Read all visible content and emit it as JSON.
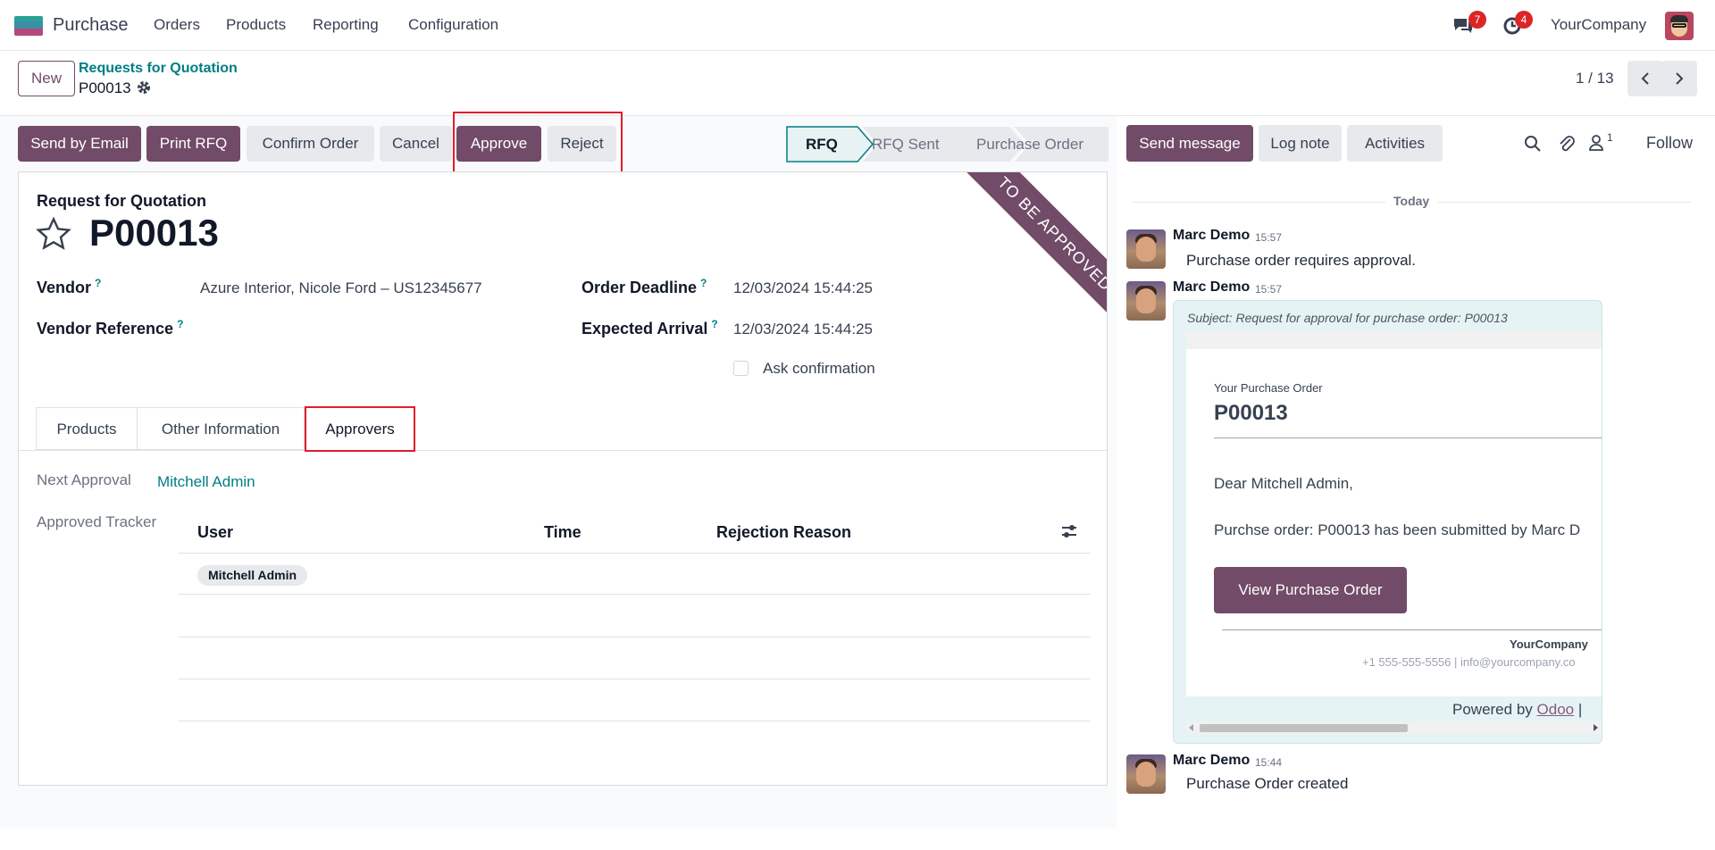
{
  "navbar": {
    "app_name": "Purchase",
    "menu": [
      "Orders",
      "Products",
      "Reporting",
      "Configuration"
    ],
    "messages_count": "7",
    "activities_count": "4",
    "company": "YourCompany"
  },
  "control_panel": {
    "new_label": "New",
    "breadcrumb_parent": "Requests for Quotation",
    "record_name": "P00013",
    "pager": "1 / 13"
  },
  "actions": {
    "send_by_email": "Send by Email",
    "print_rfq": "Print RFQ",
    "confirm_order": "Confirm Order",
    "cancel": "Cancel",
    "approve": "Approve",
    "reject": "Reject"
  },
  "statusbar": {
    "stages": [
      "RFQ",
      "RFQ Sent",
      "Purchase Order"
    ],
    "active": "RFQ"
  },
  "form": {
    "doc_type": "Request for Quotation",
    "name": "P00013",
    "ribbon": "TO BE APPROVED",
    "vendor_label": "Vendor",
    "vendor_value": "Azure Interior, Nicole Ford – US12345677",
    "vendor_ref_label": "Vendor Reference",
    "order_deadline_label": "Order Deadline",
    "order_deadline_value": "12/03/2024 15:44:25",
    "expected_arrival_label": "Expected Arrival",
    "expected_arrival_value": "12/03/2024 15:44:25",
    "ask_confirmation_label": "Ask confirmation",
    "help_mark": "?"
  },
  "tabs": [
    "Products",
    "Other Information",
    "Approvers"
  ],
  "approvers": {
    "next_approval_label": "Next Approval",
    "next_approval_value": "Mitchell Admin",
    "tracker_label": "Approved Tracker",
    "columns": [
      "User",
      "Time",
      "Rejection Reason"
    ],
    "rows": [
      {
        "user": "Mitchell Admin",
        "time": "",
        "reason": ""
      }
    ]
  },
  "chatter": {
    "send_message": "Send message",
    "log_note": "Log note",
    "activities": "Activities",
    "followers_count": "1",
    "follow": "Follow",
    "today": "Today",
    "messages": [
      {
        "author": "Marc Demo",
        "time": "15:57",
        "body": "Purchase order requires approval."
      },
      {
        "author": "Marc Demo",
        "time": "15:57",
        "subject": "Subject: Request for approval for purchase order: P00013"
      },
      {
        "author": "Marc Demo",
        "time": "15:44",
        "body": "Purchase Order created"
      }
    ],
    "email": {
      "kicker": "Your Purchase Order",
      "title": "P00013",
      "greeting": "Dear Mitchell Admin,",
      "body": "Purchse order: P00013 has been submitted by Marc D",
      "button": "View Purchase Order",
      "company": "YourCompany",
      "contact": "+1 555-555-5556 | info@yourcompany.co",
      "powered_by": "Powered by",
      "odoo": "Odoo",
      "sep": "|"
    }
  },
  "colors": {
    "primary": "#714b67",
    "link": "#017e84",
    "highlight": "#e11d2a"
  }
}
